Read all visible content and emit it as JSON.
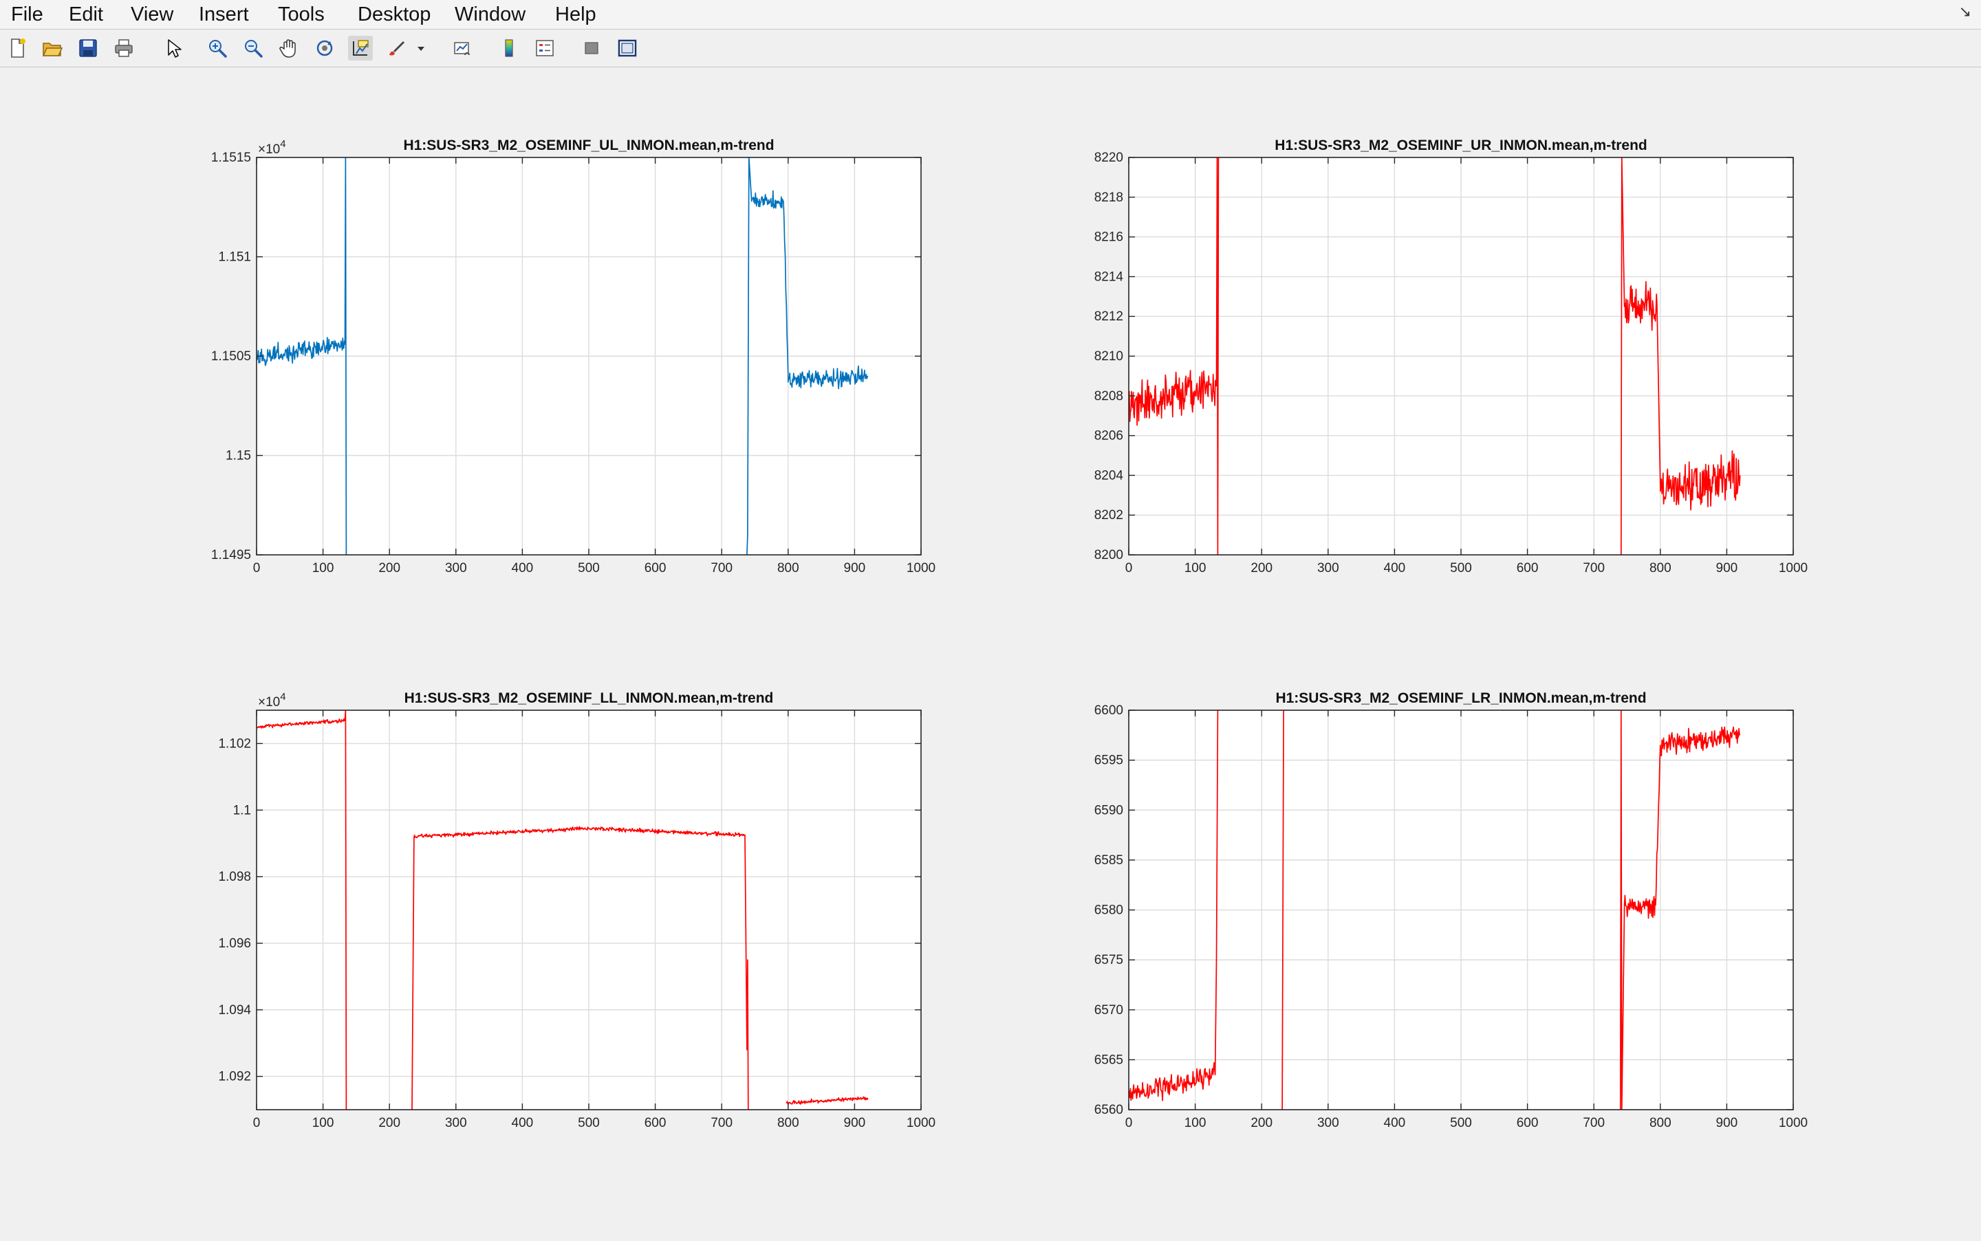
{
  "menubar": {
    "items": [
      "File",
      "Edit",
      "View",
      "Insert",
      "Tools",
      "Desktop",
      "Window",
      "Help"
    ]
  },
  "toolbar": {
    "buttons": [
      {
        "icon": "new-figure-icon"
      },
      {
        "icon": "open-file-icon"
      },
      {
        "icon": "save-icon"
      },
      {
        "icon": "print-icon"
      },
      {
        "icon": "pointer-arrow-icon"
      },
      {
        "icon": "zoom-in-icon"
      },
      {
        "icon": "zoom-out-icon"
      },
      {
        "icon": "pan-hand-icon"
      },
      {
        "icon": "rotate-3d-icon"
      },
      {
        "icon": "data-cursor-icon"
      },
      {
        "icon": "brush-icon"
      },
      {
        "icon": "dropdown-arrow-icon"
      },
      {
        "icon": "link-plot-icon"
      },
      {
        "icon": "colorbar-icon"
      },
      {
        "icon": "legend-icon"
      },
      {
        "icon": "hide-plot-tools-icon"
      },
      {
        "icon": "show-plot-tools-icon"
      }
    ]
  },
  "chart_data": [
    {
      "type": "line",
      "title": "H1:SUS-SR3_M2_OSEMINF_UL_INMON.mean,m-trend",
      "xlabel": "",
      "ylabel": "",
      "xlim": [
        0,
        1000
      ],
      "ylim": [
        11495,
        11515
      ],
      "xticks": [
        0,
        100,
        200,
        300,
        400,
        500,
        600,
        700,
        800,
        900,
        1000
      ],
      "xtick_labels": [
        "0",
        "100",
        "200",
        "300",
        "400",
        "500",
        "600",
        "700",
        "800",
        "900",
        "1000"
      ],
      "yticks": [
        11495,
        11500,
        11505,
        11510,
        11515
      ],
      "ytick_labels": [
        "1.1495",
        "1.15",
        "1.1505",
        "1.151",
        "1.1515"
      ],
      "exponent_label": "×10",
      "exponent_power": "4",
      "grid": true,
      "color": "#0072BD",
      "noise": 0.45,
      "segments": [
        {
          "x": [
            0,
            133
          ],
          "y": [
            11504.9,
            11505.6
          ]
        },
        {
          "x": [
            133,
            134
          ],
          "y": [
            11505.6,
            11515
          ]
        },
        {
          "x": [
            134,
            135
          ],
          "y": [
            11515,
            11495
          ]
        },
        {
          "x": [
            738,
            739
          ],
          "y": [
            11495,
            11496
          ]
        },
        {
          "x": [
            739,
            741
          ],
          "y": [
            11496,
            11515
          ]
        },
        {
          "x": [
            741,
            745
          ],
          "y": [
            11515,
            11512.8
          ]
        },
        {
          "x": [
            745,
            793
          ],
          "y": [
            11512.8,
            11512.8
          ]
        },
        {
          "x": [
            793,
            800
          ],
          "y": [
            11512.8,
            11504
          ]
        },
        {
          "x": [
            800,
            920
          ],
          "y": [
            11503.7,
            11504
          ]
        }
      ]
    },
    {
      "type": "line",
      "title": "H1:SUS-SR3_M2_OSEMINF_UR_INMON.mean,m-trend",
      "xlabel": "",
      "ylabel": "",
      "xlim": [
        0,
        1000
      ],
      "ylim": [
        8200,
        8220
      ],
      "xticks": [
        0,
        100,
        200,
        300,
        400,
        500,
        600,
        700,
        800,
        900,
        1000
      ],
      "xtick_labels": [
        "0",
        "100",
        "200",
        "300",
        "400",
        "500",
        "600",
        "700",
        "800",
        "900",
        "1000"
      ],
      "yticks": [
        8200,
        8202,
        8204,
        8206,
        8208,
        8210,
        8212,
        8214,
        8216,
        8218,
        8220
      ],
      "ytick_labels": [
        "8200",
        "8202",
        "8204",
        "8206",
        "8208",
        "8210",
        "8212",
        "8214",
        "8216",
        "8218",
        "8220"
      ],
      "grid": true,
      "color": "#FF0000",
      "noise": 1.1,
      "segments": [
        {
          "x": [
            0,
            132
          ],
          "y": [
            8207.5,
            8208.5
          ]
        },
        {
          "x": [
            132,
            133
          ],
          "y": [
            8208.5,
            8220
          ]
        },
        {
          "x": [
            133,
            134
          ],
          "y": [
            8220,
            8200
          ]
        },
        {
          "x": [
            134,
            135
          ],
          "y": [
            8200,
            8220
          ]
        },
        {
          "x": [
            741,
            742
          ],
          "y": [
            8200,
            8220
          ]
        },
        {
          "x": [
            742,
            746
          ],
          "y": [
            8220,
            8212.5
          ]
        },
        {
          "x": [
            746,
            795
          ],
          "y": [
            8212.5,
            8212.5
          ]
        },
        {
          "x": [
            795,
            800
          ],
          "y": [
            8212.5,
            8203.5
          ]
        },
        {
          "x": [
            800,
            920
          ],
          "y": [
            8203.2,
            8204
          ]
        }
      ]
    },
    {
      "type": "line",
      "title": "H1:SUS-SR3_M2_OSEMINF_LL_INMON.mean,m-trend",
      "xlabel": "",
      "ylabel": "",
      "xlim": [
        0,
        1000
      ],
      "ylim": [
        10910,
        11030
      ],
      "xticks": [
        0,
        100,
        200,
        300,
        400,
        500,
        600,
        700,
        800,
        900,
        1000
      ],
      "xtick_labels": [
        "0",
        "100",
        "200",
        "300",
        "400",
        "500",
        "600",
        "700",
        "800",
        "900",
        "1000"
      ],
      "yticks": [
        10920,
        10940,
        10960,
        10980,
        11000,
        11020
      ],
      "ytick_labels": [
        "1.092",
        "1.094",
        "1.096",
        "1.098",
        "1.1",
        "1.102"
      ],
      "exponent_label": "×10",
      "exponent_power": "4",
      "grid": true,
      "color": "#FF0000",
      "noise": 0.55,
      "segments": [
        {
          "x": [
            0,
            133
          ],
          "y": [
            11025,
            11027
          ]
        },
        {
          "x": [
            133,
            134
          ],
          "y": [
            11027,
            11030
          ]
        },
        {
          "x": [
            134,
            135
          ],
          "y": [
            11030,
            10910
          ]
        },
        {
          "x": [
            234,
            237
          ],
          "y": [
            10910,
            10992
          ]
        },
        {
          "x": [
            237,
            500
          ],
          "y": [
            10992,
            10994.5
          ]
        },
        {
          "x": [
            500,
            735
          ],
          "y": [
            10994.5,
            10992.5
          ]
        },
        {
          "x": [
            735,
            738
          ],
          "y": [
            10992.5,
            10928
          ]
        },
        {
          "x": [
            738,
            739
          ],
          "y": [
            10928,
            10955
          ]
        },
        {
          "x": [
            739,
            740
          ],
          "y": [
            10955,
            10910
          ]
        },
        {
          "x": [
            797,
            920
          ],
          "y": [
            10912,
            10913.5
          ]
        }
      ]
    },
    {
      "type": "line",
      "title": "H1:SUS-SR3_M2_OSEMINF_LR_INMON.mean,m-trend",
      "xlabel": "",
      "ylabel": "",
      "xlim": [
        0,
        1000
      ],
      "ylim": [
        6560,
        6600
      ],
      "xticks": [
        0,
        100,
        200,
        300,
        400,
        500,
        600,
        700,
        800,
        900,
        1000
      ],
      "xtick_labels": [
        "0",
        "100",
        "200",
        "300",
        "400",
        "500",
        "600",
        "700",
        "800",
        "900",
        "1000"
      ],
      "yticks": [
        6560,
        6565,
        6570,
        6575,
        6580,
        6585,
        6590,
        6595,
        6600
      ],
      "ytick_labels": [
        "6560",
        "6565",
        "6570",
        "6575",
        "6580",
        "6585",
        "6590",
        "6595",
        "6600"
      ],
      "grid": true,
      "color": "#FF0000",
      "noise": 1.1,
      "segments": [
        {
          "x": [
            0,
            130
          ],
          "y": [
            6561.5,
            6563.5
          ]
        },
        {
          "x": [
            130,
            132
          ],
          "y": [
            6563.5,
            6575
          ]
        },
        {
          "x": [
            132,
            134
          ],
          "y": [
            6575,
            6600
          ]
        },
        {
          "x": [
            231,
            233
          ],
          "y": [
            6560,
            6600
          ]
        },
        {
          "x": [
            740,
            741
          ],
          "y": [
            6560,
            6600
          ]
        },
        {
          "x": [
            741,
            742
          ],
          "y": [
            6600,
            6560
          ]
        },
        {
          "x": [
            742,
            746
          ],
          "y": [
            6560,
            6580.5
          ]
        },
        {
          "x": [
            746,
            793
          ],
          "y": [
            6580.5,
            6580.5
          ]
        },
        {
          "x": [
            793,
            800
          ],
          "y": [
            6580.5,
            6596.5
          ]
        },
        {
          "x": [
            800,
            920
          ],
          "y": [
            6596.5,
            6597.5
          ]
        }
      ]
    }
  ]
}
